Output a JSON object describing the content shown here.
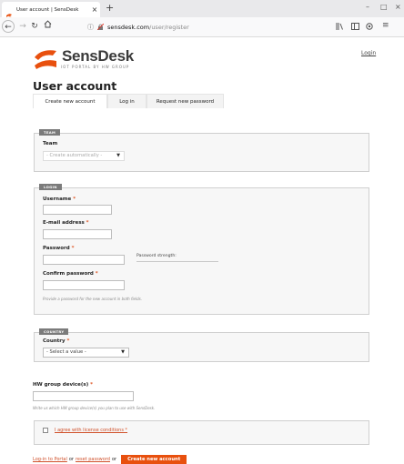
{
  "browser": {
    "tab_title": "User account | SensDesk",
    "tab_close": "×",
    "new_tab": "+",
    "win_min": "–",
    "win_max": "□",
    "win_close": "×",
    "url_info": "ⓘ",
    "url_domain": "sensdesk.com",
    "url_path": "/user/register",
    "brand_color": "#e8500e"
  },
  "header": {
    "logo_text": "SensDesk",
    "logo_sub": "IOT PORTAL BY HW GROUP",
    "login_link": "Login"
  },
  "page": {
    "title": "User account",
    "tabs": [
      {
        "label": "Create new account"
      },
      {
        "label": "Log in"
      },
      {
        "label": "Request new password"
      }
    ]
  },
  "form": {
    "team": {
      "legend": "TEAM",
      "label": "Team",
      "select_value": "- Create automatically -"
    },
    "login": {
      "legend": "LOGIN",
      "username_label": "Username",
      "email_label": "E-mail address",
      "password_label": "Password",
      "strength_label": "Password strength:",
      "confirm_label": "Confirm password",
      "hint": "Provide a password for the new account in both fields."
    },
    "country": {
      "legend": "COUNTRY",
      "label": "Country",
      "select_value": "- Select a value -"
    },
    "devices": {
      "label": "HW group device(s)",
      "hint": "Write us which HW group device(s) you plan to use with SensDesk."
    },
    "license": {
      "label": "I agree with license conditions"
    },
    "required_mark": "*"
  },
  "footer": {
    "portal_link": "Log-in to Portal",
    "or1": "or",
    "reset_link": "reset password",
    "or2": "or",
    "create_button": "Create new account"
  }
}
